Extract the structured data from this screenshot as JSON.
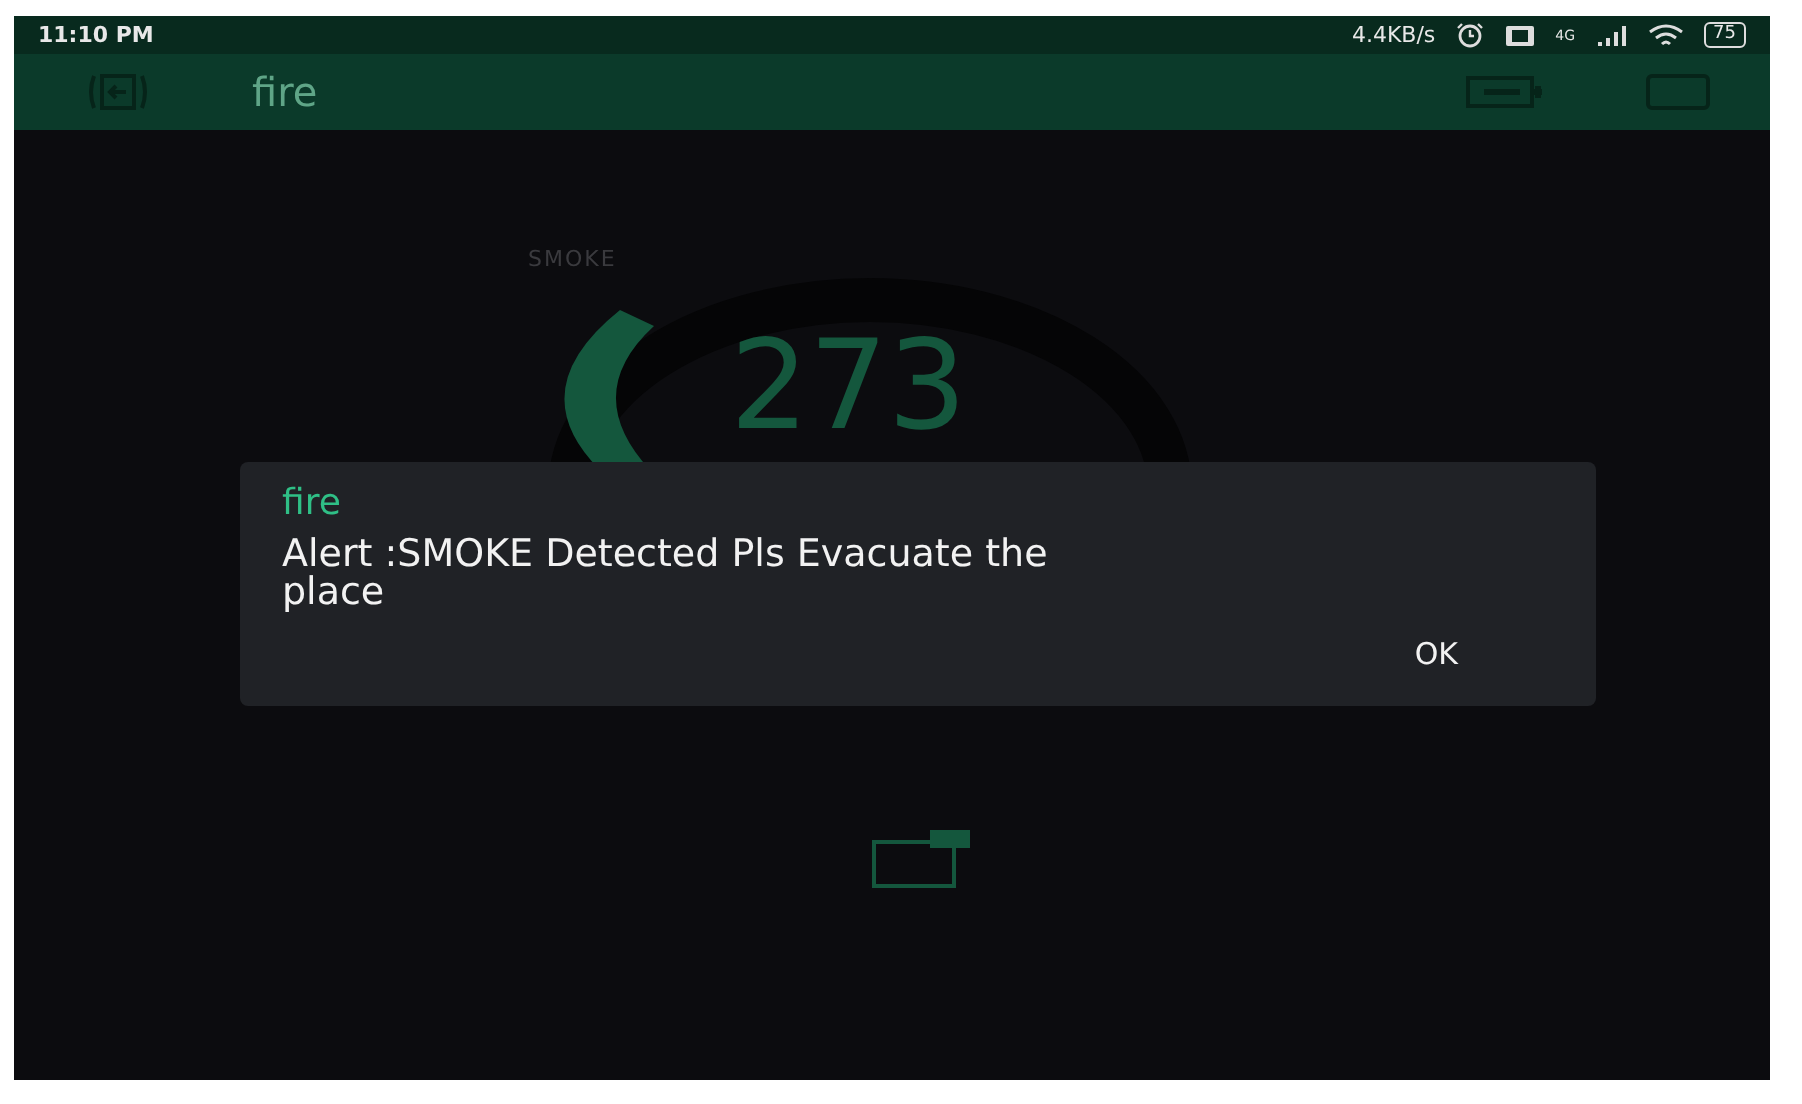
{
  "status_bar": {
    "time": "11:10 PM",
    "network_speed": "4.4KB/s",
    "network_type": "4G",
    "battery": "75"
  },
  "app_bar": {
    "title": "fire"
  },
  "gauge": {
    "label": "SMOKE",
    "value": "273"
  },
  "dialog": {
    "title": "fire",
    "message": "Alert :SMOKE Detected Pls Evacuate the place",
    "buttons": [
      "OK"
    ]
  }
}
